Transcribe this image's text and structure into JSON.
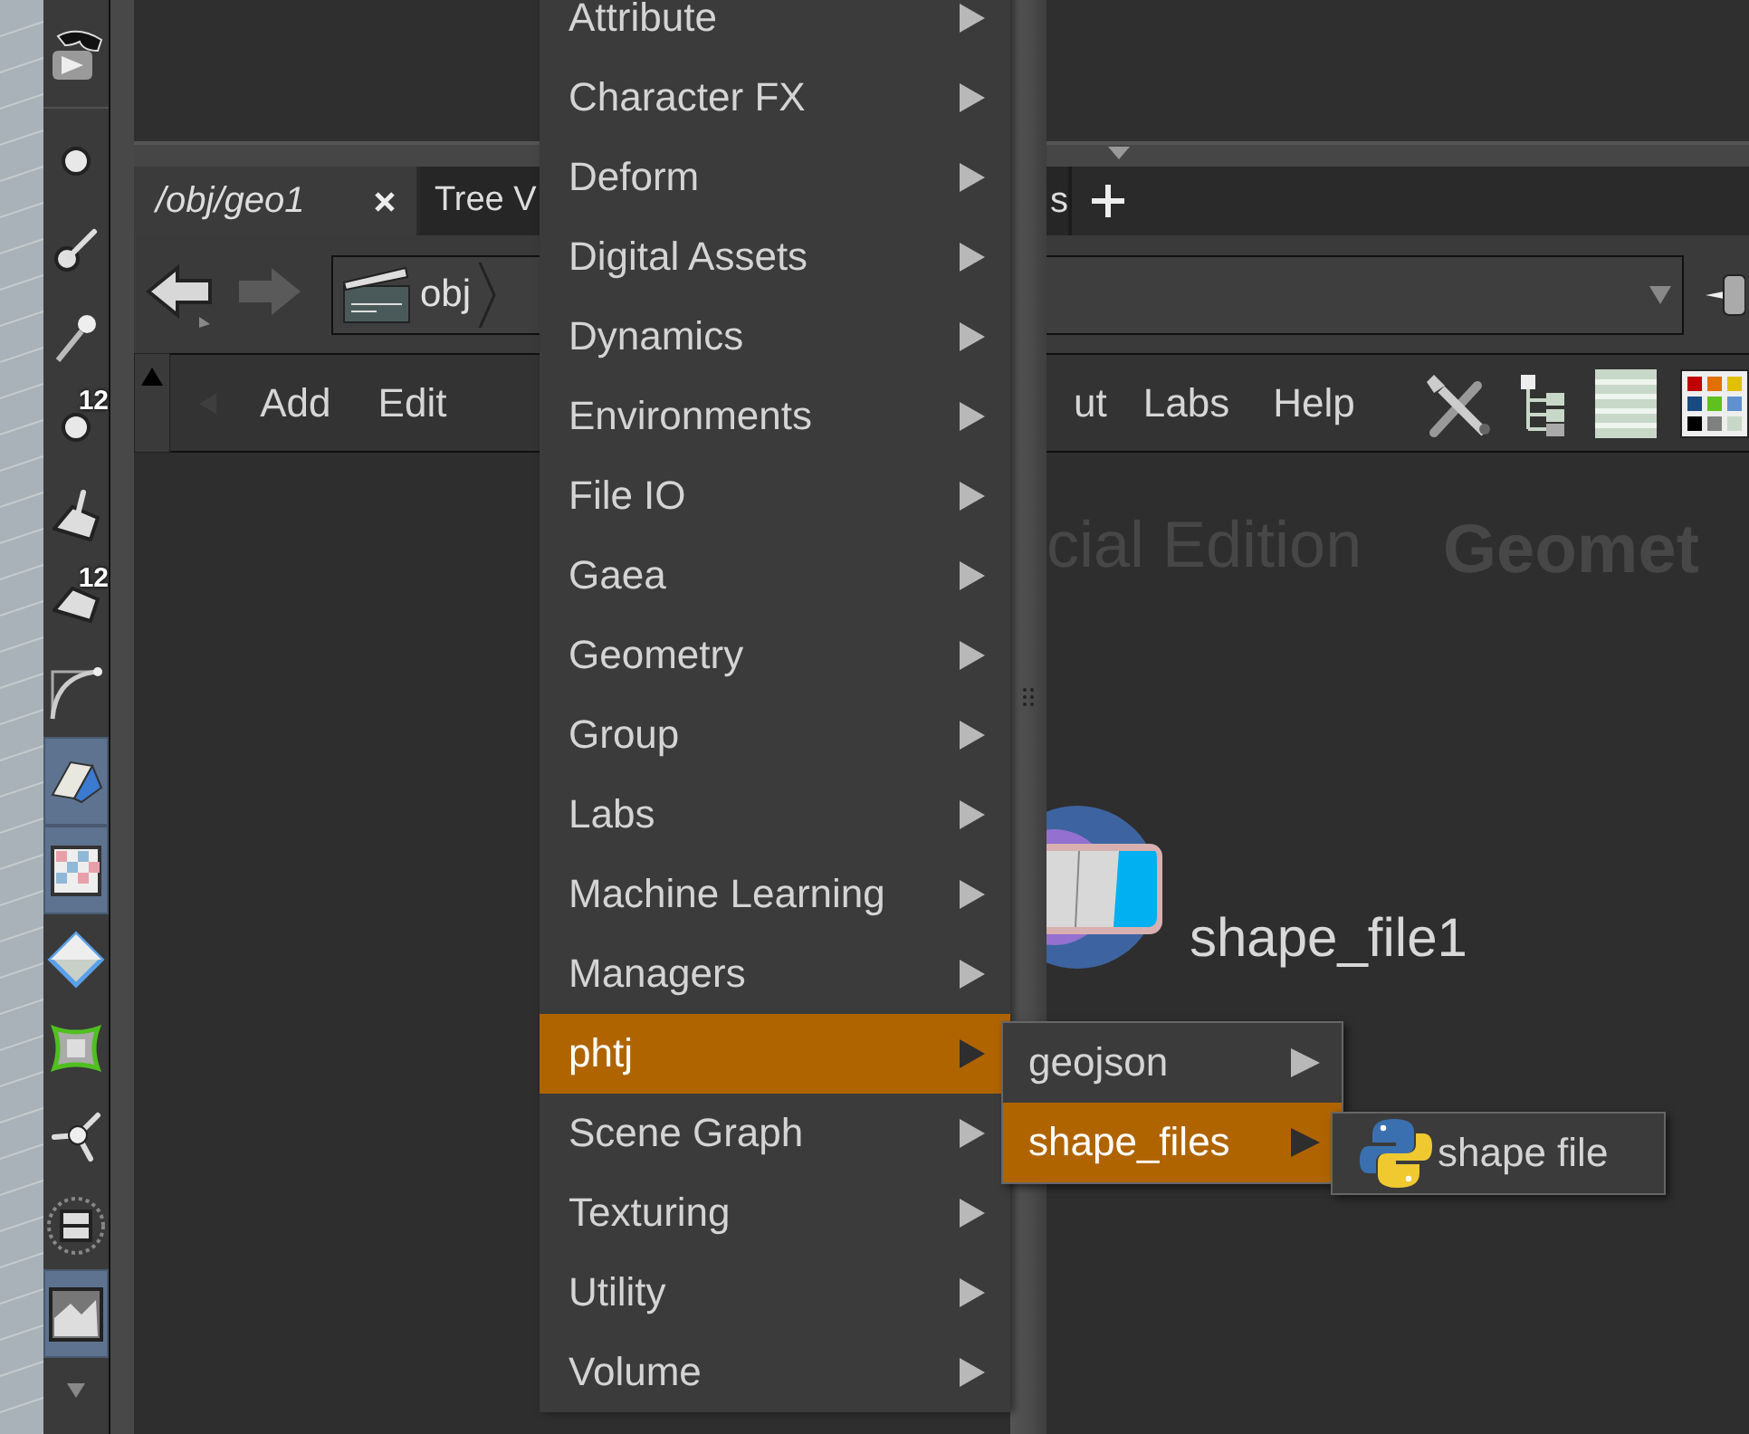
{
  "shelf_tools": [
    {
      "active": false
    },
    {
      "active": false
    },
    {
      "active": false
    },
    {
      "active": false
    },
    {
      "active": false,
      "badge": "12"
    },
    {
      "active": false
    },
    {
      "active": false,
      "badge": "12"
    },
    {
      "active": false
    },
    {
      "active": true
    },
    {
      "active": true
    },
    {
      "active": false
    },
    {
      "active": false
    },
    {
      "active": false
    },
    {
      "active": false
    },
    {
      "active": true
    }
  ],
  "tabs": [
    {
      "label": "/obj/geo1",
      "selected": true
    },
    {
      "label": "Tree V",
      "selected": false
    },
    {
      "label": "s",
      "selected": false
    }
  ],
  "path": {
    "crumbs": [
      {
        "label": "obj"
      }
    ]
  },
  "menubar": {
    "left": [
      "Add",
      "Edit"
    ],
    "right": [
      "ut",
      "Labs",
      "Help"
    ]
  },
  "network": {
    "watermark": [
      "cial Edition",
      "Geomet"
    ],
    "node": {
      "label": "shape_file1"
    }
  },
  "tab_menu": {
    "items": [
      {
        "label": "Attribute",
        "selected": false
      },
      {
        "label": "Character FX",
        "selected": false
      },
      {
        "label": "Deform",
        "selected": false
      },
      {
        "label": "Digital Assets",
        "selected": false
      },
      {
        "label": "Dynamics",
        "selected": false
      },
      {
        "label": "Environments",
        "selected": false
      },
      {
        "label": "File IO",
        "selected": false
      },
      {
        "label": "Gaea",
        "selected": false
      },
      {
        "label": "Geometry",
        "selected": false
      },
      {
        "label": "Group",
        "selected": false
      },
      {
        "label": "Labs",
        "selected": false
      },
      {
        "label": "Machine Learning",
        "selected": false
      },
      {
        "label": "Managers",
        "selected": false
      },
      {
        "label": "phtj",
        "selected": true
      },
      {
        "label": "Scene Graph",
        "selected": false
      },
      {
        "label": "Texturing",
        "selected": false
      },
      {
        "label": "Utility",
        "selected": false
      },
      {
        "label": "Volume",
        "selected": false
      }
    ]
  },
  "submenu": {
    "items": [
      {
        "label": "geojson",
        "selected": false
      },
      {
        "label": "shape_files",
        "selected": true
      }
    ]
  },
  "submenu2": {
    "items": [
      {
        "label": "shape file"
      }
    ]
  }
}
